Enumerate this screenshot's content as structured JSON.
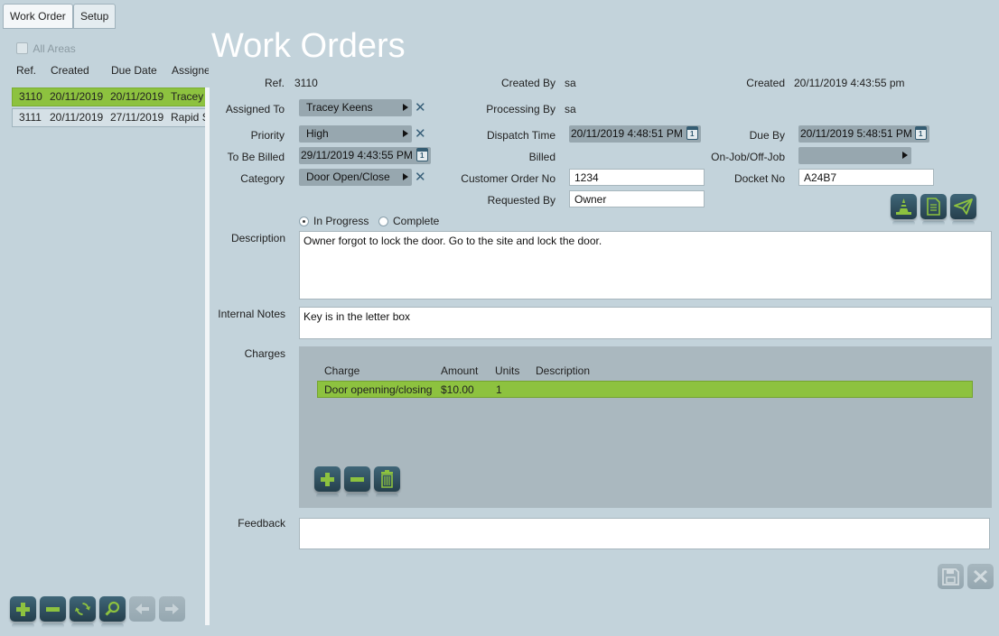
{
  "tabs": [
    {
      "label": "Work Order",
      "active": true
    },
    {
      "label": "Setup",
      "active": false
    }
  ],
  "left": {
    "all_areas_label": "All Areas",
    "all_areas_checked": false,
    "columns": [
      "Ref.",
      "Created",
      "Due Date",
      "Assigned To"
    ],
    "rows": [
      {
        "ref": "3110",
        "created": "20/11/2019",
        "due": "20/11/2019",
        "assigned": "Tracey Keens",
        "selected": true
      },
      {
        "ref": "3111",
        "created": "20/11/2019",
        "due": "27/11/2019",
        "assigned": "Rapid Services",
        "selected": false
      }
    ],
    "toolbar_icons": [
      "add-icon",
      "remove-icon",
      "refresh-icon",
      "search-icon",
      "arrow-left-icon",
      "arrow-right-icon"
    ]
  },
  "page_title": "Work Orders",
  "form": {
    "ref_label": "Ref.",
    "ref_value": "3110",
    "created_by_label": "Created By",
    "created_by_value": "sa",
    "created_label": "Created",
    "created_value": "20/11/2019 4:43:55 pm",
    "assigned_to_label": "Assigned To",
    "assigned_to_value": "Tracey Keens",
    "processing_by_label": "Processing By",
    "processing_by_value": "sa",
    "priority_label": "Priority",
    "priority_value": "High",
    "dispatch_time_label": "Dispatch Time",
    "dispatch_time_value": "20/11/2019 4:48:51 PM",
    "due_by_label": "Due By",
    "due_by_value": "20/11/2019 5:48:51 PM",
    "to_be_billed_label": "To Be Billed",
    "to_be_billed_value": "29/11/2019 4:43:55 PM",
    "billed_label": "Billed",
    "on_off_job_label": "On-Job/Off-Job",
    "on_off_job_value": "",
    "category_label": "Category",
    "category_value": "Door Open/Close",
    "customer_order_label": "Customer Order No",
    "customer_order_value": "1234",
    "docket_label": "Docket No",
    "docket_value": "A24B7",
    "requested_by_label": "Requested By",
    "requested_by_value": "Owner",
    "status_options": [
      {
        "label": "In Progress",
        "checked": true
      },
      {
        "label": "Complete",
        "checked": false
      }
    ],
    "description_label": "Description",
    "description_value": "Owner forgot to lock the door. Go to the site and lock the door.",
    "internal_notes_label": "Internal Notes",
    "internal_notes_value": "Key is in the letter box",
    "charges_label": "Charges",
    "charges_columns": [
      "Charge",
      "Amount",
      "Units",
      "Description"
    ],
    "charges_rows": [
      {
        "charge": "Door openning/closing",
        "amount": "$10.00",
        "units": "1",
        "description": ""
      }
    ],
    "feedback_label": "Feedback",
    "feedback_value": "",
    "calendar_glyph": "1"
  },
  "colors": {
    "background": "#c3d3db",
    "selected_row": "#8dc23f",
    "icon_button": "#2f4f5e",
    "icon_accent": "#8dc23f",
    "heading": "#ffffff"
  }
}
